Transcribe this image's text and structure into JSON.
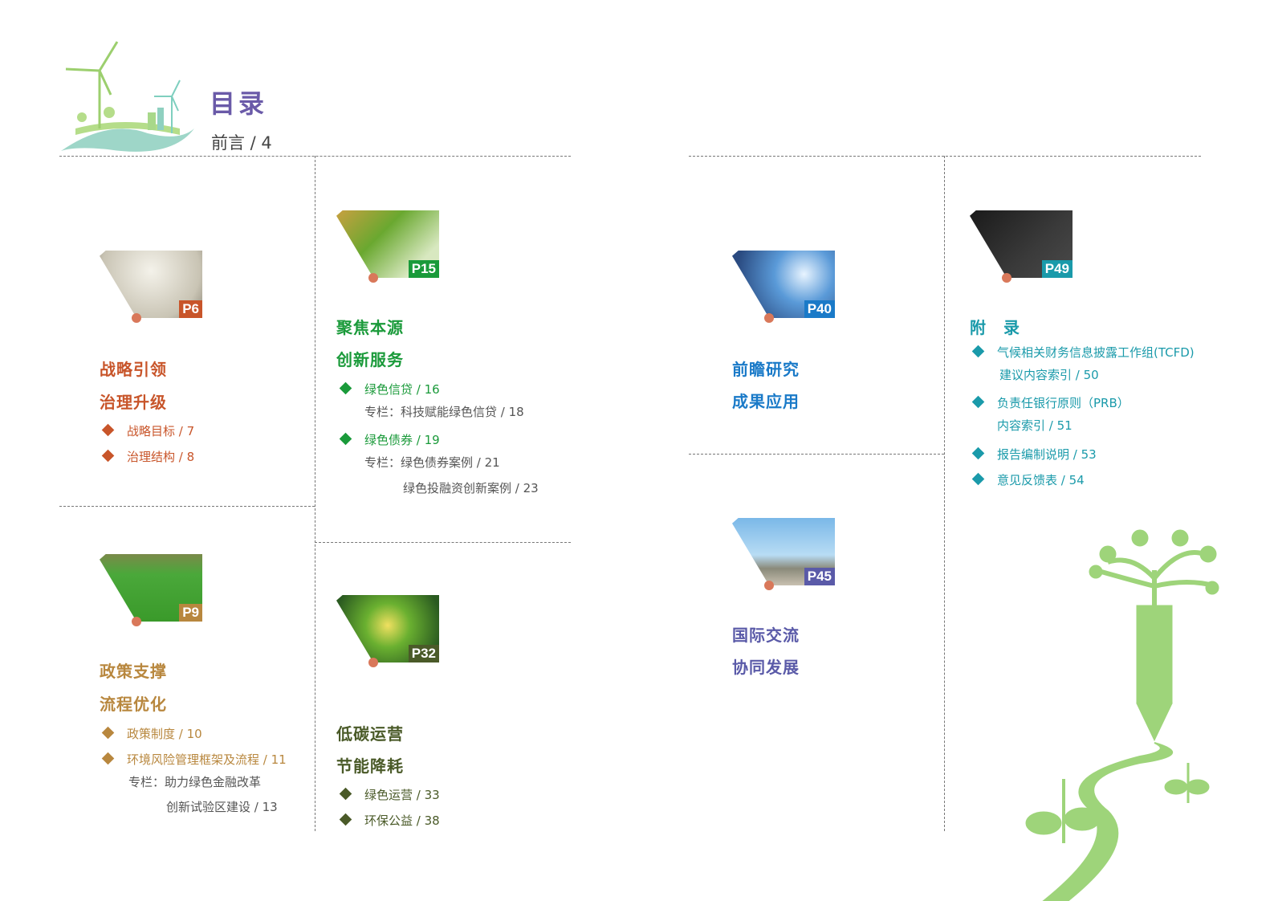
{
  "header": {
    "title": "目录",
    "preface": "前言 / 4"
  },
  "colors": {
    "s1": "#c8552a",
    "s2": "#1a9a3a",
    "s3": "#b8873e",
    "s4": "#4a5a28",
    "s5": "#1a7ac8",
    "s6": "#5a5aa8",
    "s7": "#1a9aaa"
  },
  "sections": [
    {
      "badge": "P6",
      "titles": [
        "战略引领",
        "治理升级"
      ],
      "items": [
        "战略目标 / 7",
        "治理结构 / 8"
      ]
    },
    {
      "badge": "P15",
      "titles": [
        "聚焦本源",
        "创新服务"
      ],
      "items": [
        "绿色信贷 / 16",
        "绿色债券 / 19"
      ],
      "subs": [
        "专栏：科技赋能绿色信贷 / 18",
        "专栏：绿色债券案例 / 21",
        "绿色投融资创新案例 / 23"
      ]
    },
    {
      "badge": "P9",
      "titles": [
        "政策支撑",
        "流程优化"
      ],
      "items": [
        "政策制度 / 10",
        "环境风险管理框架及流程 / 11"
      ],
      "subs": [
        "专栏：助力绿色金融改革",
        "创新试验区建设 / 13"
      ]
    },
    {
      "badge": "P32",
      "titles": [
        "低碳运营",
        "节能降耗"
      ],
      "items": [
        "绿色运营 / 33",
        "环保公益 / 38"
      ]
    },
    {
      "badge": "P40",
      "titles": [
        "前瞻研究",
        "成果应用"
      ]
    },
    {
      "badge": "P45",
      "titles": [
        "国际交流",
        "协同发展"
      ]
    },
    {
      "badge": "P49",
      "titles": [
        "附　录"
      ],
      "items": [
        "气候相关财务信息披露工作组(TCFD)",
        "负责任银行原则（PRB）",
        "报告编制说明 / 53",
        "意见反馈表 / 54"
      ],
      "subs": [
        "建议内容索引 / 50",
        "内容索引 / 51"
      ]
    }
  ]
}
